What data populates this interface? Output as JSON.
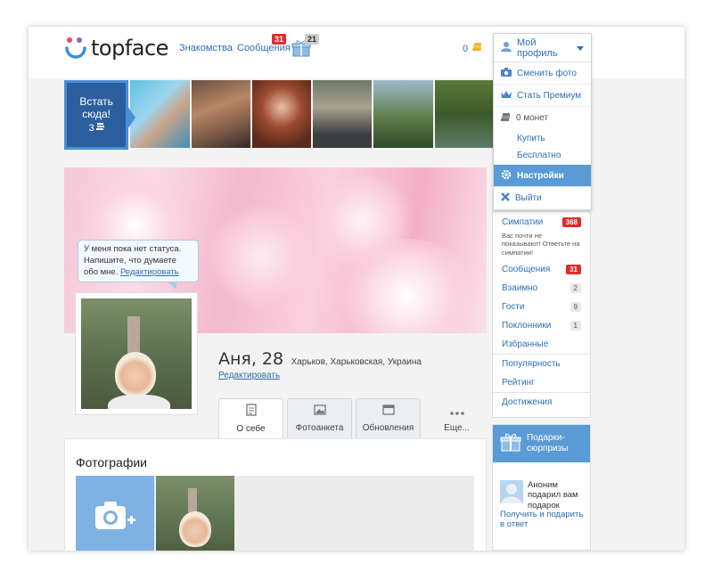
{
  "logo": {
    "text": "topface"
  },
  "nav": {
    "dating": "Знакомства",
    "messages": "Сообщения",
    "messages_badge": "31",
    "gifts_badge": "21",
    "coins": "0"
  },
  "profile_menu": {
    "title": "Мой профиль",
    "change_photo": "Сменить фото",
    "premium": "Стать Премиум",
    "coins_label": "0 монет",
    "buy": "Купить",
    "free": "Бесплатно",
    "settings": "Настройки",
    "logout": "Выйти"
  },
  "strip": {
    "cta_line1": "Встать",
    "cta_line2": "сюда!",
    "cta_cost": "3"
  },
  "bubble": {
    "text": "У меня пока нет статуса. Напишите, что думаете обо мне.",
    "edit": "Редактировать"
  },
  "profile": {
    "name": "Аня, 28",
    "location": "Харьков, Харьковская, Украина",
    "edit": "Редактировать"
  },
  "tabs": [
    {
      "label": "О себе",
      "icon": "profile-icon"
    },
    {
      "label": "Фотоанкета",
      "icon": "photo-icon"
    },
    {
      "label": "Обновления",
      "icon": "calendar-icon"
    },
    {
      "label": "Еще...",
      "icon": "more-icon"
    }
  ],
  "photos": {
    "title": "Фотографии"
  },
  "sidebar": {
    "sympathies": "Симпатии",
    "sympathies_count": "368",
    "sympathies_note": "Вас почти не показывают! Ответьте на симпатии!",
    "messages": "Сообщения",
    "messages_count": "31",
    "mutual": "Взаимно",
    "mutual_count": "2",
    "guests": "Гости",
    "guests_count": "9",
    "fans": "Поклонники",
    "fans_count": "1",
    "favorites": "Избранные",
    "popularity": "Популярность",
    "rating": "Рейтинг",
    "achievements": "Достижения"
  },
  "gifts": {
    "title": "Подарки-сюрпризы",
    "entry": "Аноним подарил вам подарок",
    "action": "Получить и подарить в ответ"
  },
  "colors": {
    "accent": "#2c6fb6",
    "menu_active": "#5b9bd5",
    "badge": "#e02b27"
  }
}
